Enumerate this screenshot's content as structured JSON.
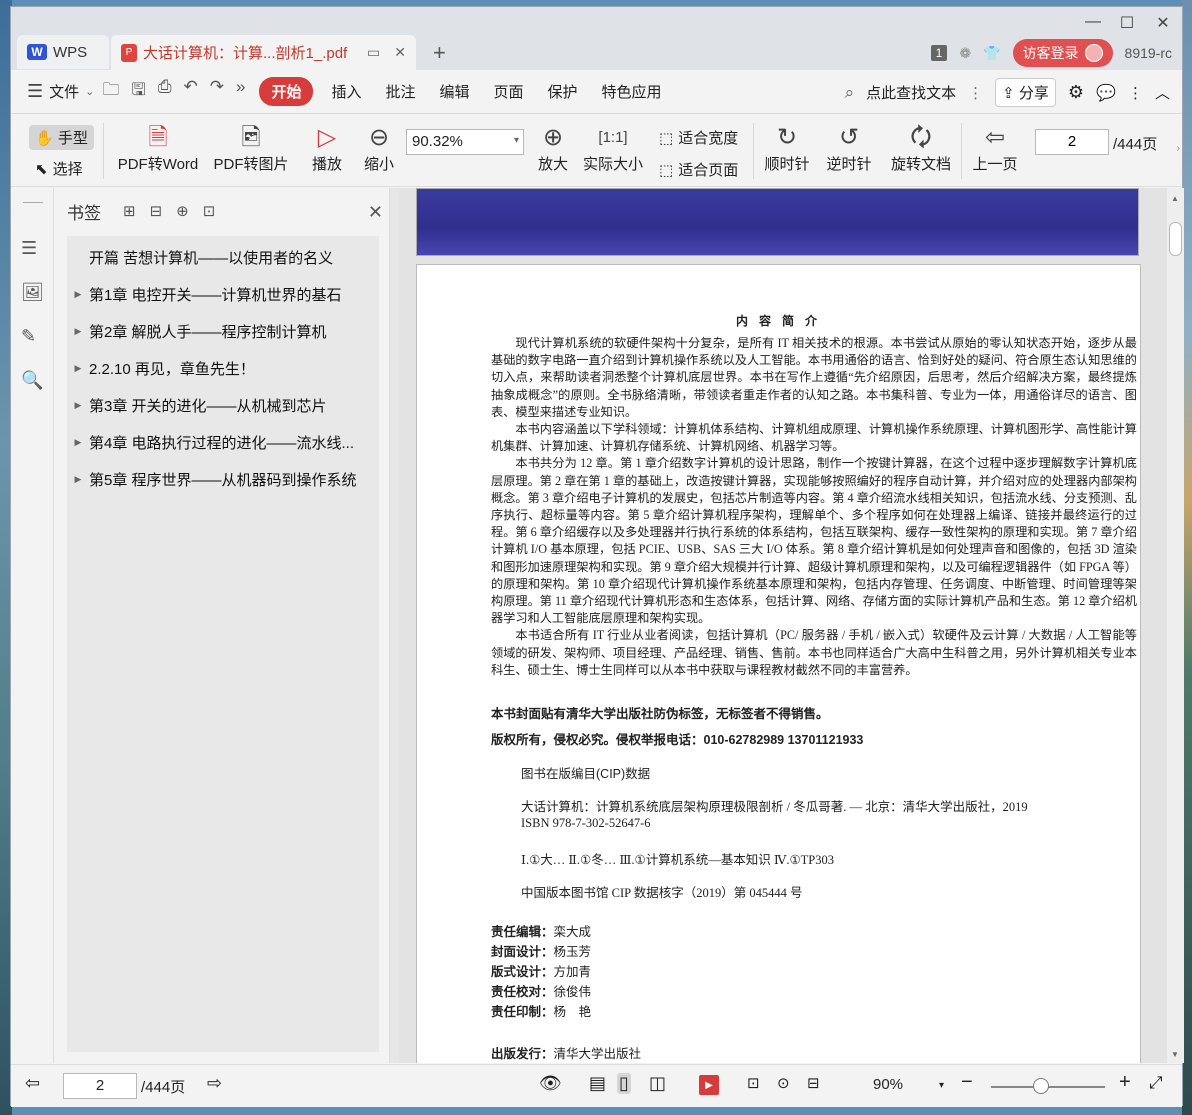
{
  "titlebar": {
    "wps_tab": "WPS",
    "doc_tab": "大话计算机：计算...剖析1_.pdf",
    "page_badge": "1",
    "login": "访客登录",
    "user_id": "8919-rc"
  },
  "menu": {
    "file": "文件",
    "items": [
      "开始",
      "插入",
      "批注",
      "编辑",
      "页面",
      "保护",
      "特色应用"
    ],
    "search": "点此查找文本",
    "share": "分享"
  },
  "ribbon": {
    "hand": "手型",
    "select": "选择",
    "pdf_to_word": "PDF转Word",
    "pdf_to_image": "PDF转图片",
    "play": "播放",
    "zoom_out": "缩小",
    "zoom_value": "90.32%",
    "zoom_in": "放大",
    "actual_size": "实际大小",
    "fit_width": "适合宽度",
    "fit_page": "适合页面",
    "clockwise": "顺时针",
    "counterclockwise": "逆时针",
    "rotate_doc": "旋转文档",
    "prev_page": "上一页",
    "page_value": "2",
    "page_total": "/444页"
  },
  "bookmarks": {
    "title": "书签",
    "items": [
      {
        "label": "开篇  苦想计算机——以使用者的名义",
        "expandable": false
      },
      {
        "label": "第1章  电控开关——计算机世界的基石",
        "expandable": true
      },
      {
        "label": "第2章  解脱人手——程序控制计算机",
        "expandable": true
      },
      {
        "label": "2.2.10  再见，章鱼先生！",
        "expandable": true
      },
      {
        "label": "第3章  开关的进化——从机械到芯片",
        "expandable": true
      },
      {
        "label": "第4章  电路执行过程的进化——流水线...",
        "expandable": true
      },
      {
        "label": "第5章  程序世界——从机器码到操作系统",
        "expandable": true
      }
    ]
  },
  "page": {
    "title": "内 容 简 介",
    "p1": "现代计算机系统的软硬件架构十分复杂，是所有 IT 相关技术的根源。本书尝试从原始的零认知状态开始，逐步从最基础的数字电路一直介绍到计算机操作系统以及人工智能。本书用通俗的语言、恰到好处的疑问、符合原生态认知思维的切入点，来帮助读者洞悉整个计算机底层世界。本书在写作上遵循“先介绍原因，后思考，然后介绍解决方案，最终提炼抽象成概念”的原则。全书脉络清晰，带领读者重走作者的认知之路。本书集科普、专业为一体，用通俗详尽的语言、图表、模型来描述专业知识。",
    "p2": "本书内容涵盖以下学科领域：计算机体系结构、计算机组成原理、计算机操作系统原理、计算机图形学、高性能计算机集群、计算加速、计算机存储系统、计算机网络、机器学习等。",
    "p3": "本书共分为 12 章。第 1 章介绍数字计算机的设计思路，制作一个按键计算器，在这个过程中逐步理解数字计算机底层原理。第 2 章在第 1 章的基础上，改造按键计算器，实现能够按照编好的程序自动计算，并介绍对应的处理器内部架构概念。第 3 章介绍电子计算机的发展史，包括芯片制造等内容。第 4 章介绍流水线相关知识，包括流水线、分支预测、乱序执行、超标量等内容。第 5 章介绍计算机程序架构，理解单个、多个程序如何在处理器上编译、链接并最终运行的过程。第 6 章介绍缓存以及多处理器并行执行系统的体系结构，包括互联架构、缓存一致性架构的原理和实现。第 7 章介绍计算机 I/O 基本原理，包括 PCIE、USB、SAS 三大 I/O 体系。第 8 章介绍计算机是如何处理声音和图像的，包括 3D 渲染和图形加速原理架构和实现。第 9 章介绍大规模并行计算、超级计算机原理和架构，以及可编程逻辑器件（如 FPGA 等）的原理和架构。第 10 章介绍现代计算机操作系统基本原理和架构，包括内存管理、任务调度、中断管理、时间管理等架构原理。第 11 章介绍现代计算机形态和生态体系，包括计算、网络、存储方面的实际计算机产品和生态。第 12 章介绍机器学习和人工智能底层原理和架构实现。",
    "p4": "本书适合所有 IT 行业从业者阅读，包括计算机（PC/ 服务器 / 手机 / 嵌入式）软硬件及云计算 / 大数据 / 人工智能等领域的研发、架构师、项目经理、产品经理、销售、售前。本书也同样适合广大高中生科普之用，另外计算机相关专业本科生、硕士生、博士生同样可以从本书中获取与课程教材截然不同的丰富营养。",
    "notice": "本书封面贴有清华大学出版社防伪标签，无标签者不得销售。",
    "copyright": "版权所有，侵权必究。侵权举报电话：010-62782989  13701121933",
    "cip_title": "图书在版编目(CIP)数据",
    "cip_line1": "大话计算机：计算机系统底层架构原理极限剖析 / 冬瓜哥著. — 北京：清华大学出版社，2019",
    "cip_line2": "ISBN 978-7-302-52647-6",
    "cip_line3": "Ⅰ.①大…   Ⅱ.①冬…   Ⅲ.①计算机系统—基本知识   Ⅳ.①TP303",
    "cip_line4": "中国版本图书馆 CIP 数据核字（2019）第 045444 号",
    "credits": [
      {
        "role": "责任编辑：",
        "name": "栾大成"
      },
      {
        "role": "封面设计：",
        "name": "杨玉芳"
      },
      {
        "role": "版式设计：",
        "name": "方加青"
      },
      {
        "role": "责任校对：",
        "name": "徐俊伟"
      },
      {
        "role": "责任印制：",
        "name": "杨　艳"
      }
    ],
    "publisher_role": "出版发行：",
    "publisher": "清华大学出版社"
  },
  "status": {
    "page_value": "2",
    "page_total": "/444页",
    "zoom": "90%"
  }
}
